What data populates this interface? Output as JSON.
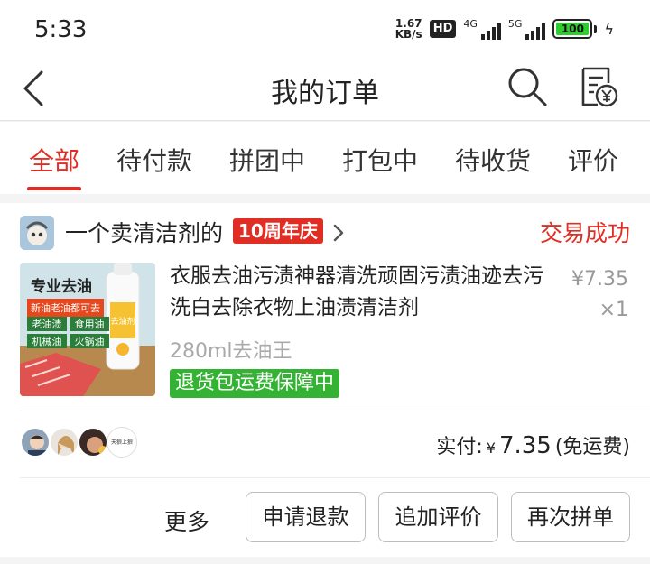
{
  "status_bar": {
    "time": "5:33",
    "speed_value": "1.67",
    "speed_unit": "KB/s",
    "hd": "HD",
    "net1": "4G",
    "net2": "5G",
    "battery": "100"
  },
  "navbar": {
    "title": "我的订单"
  },
  "tabs": [
    "全部",
    "待付款",
    "拼团中",
    "打包中",
    "待收货",
    "评价"
  ],
  "active_tab": "全部",
  "order": {
    "shop_name": "一个卖清洁剂的",
    "anniversary_badge": "10周年庆",
    "status": "交易成功",
    "thumbnail": {
      "title": "专业去油",
      "subtitle": "新油老油都可去",
      "tags": [
        "老油渍",
        "食用油",
        "机械油",
        "火锅油"
      ],
      "bottle_label": "去油剂"
    },
    "product_title": "衣服去油污渍神器清洗顽固污渍油迹去污洗白去除衣物上油渍清洁剂",
    "price": "¥7.35",
    "quantity": "×1",
    "spec": "280ml去油王",
    "return_badge": "退货包运费保障中",
    "paid_label": "实付:",
    "paid_currency": "¥",
    "paid_amount": "7.35",
    "shipping_note": "(免运费)",
    "buyer_4_text": "天狼上狼"
  },
  "actions": {
    "more": "更多",
    "refund": "申请退款",
    "add_review": "追加评价",
    "reorder": "再次拼单"
  },
  "colors": {
    "accent": "#e02e24",
    "green_badge": "#34b233",
    "battery": "#2ecc2e"
  }
}
